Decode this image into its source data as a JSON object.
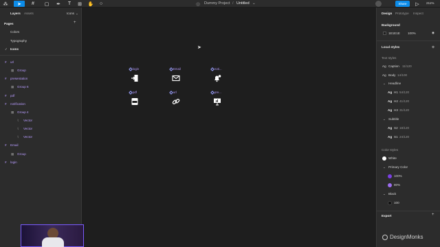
{
  "toolbar": {
    "project": "Dummy Project",
    "file": "Untitled",
    "share": "Share",
    "zoom": "211%",
    "design_tab": "Design",
    "prototype_tab": "Prototype",
    "inspect_tab": "Inspect"
  },
  "left": {
    "tab_layers": "Layers",
    "tab_assets": "Assets",
    "page_current": "Icons",
    "pages_label": "Pages",
    "pages": [
      "Colors",
      "Typography",
      "Icons"
    ],
    "layers": [
      {
        "label": "url",
        "level": 0,
        "type": "frame"
      },
      {
        "label": "Group",
        "level": 1,
        "type": "group"
      },
      {
        "label": "presentation",
        "level": 0,
        "type": "frame"
      },
      {
        "label": "Group 6",
        "level": 1,
        "type": "group"
      },
      {
        "label": "pdf",
        "level": 0,
        "type": "frame"
      },
      {
        "label": "notification",
        "level": 0,
        "type": "frame"
      },
      {
        "label": "Group 4",
        "level": 1,
        "type": "group"
      },
      {
        "label": "Vector",
        "level": 2,
        "type": "vector"
      },
      {
        "label": "Vector",
        "level": 2,
        "type": "vector"
      },
      {
        "label": "Vector",
        "level": 2,
        "type": "vector"
      },
      {
        "label": "Email",
        "level": 0,
        "type": "frame"
      },
      {
        "label": "Group",
        "level": 1,
        "type": "group"
      },
      {
        "label": "login",
        "level": 0,
        "type": "frame"
      }
    ]
  },
  "canvas": {
    "icons": [
      {
        "label": "login",
        "icon": "login-icon"
      },
      {
        "label": "Email",
        "icon": "email-icon"
      },
      {
        "label": "noti...",
        "icon": "bell-icon"
      },
      {
        "label": "pdf",
        "icon": "pdf-icon"
      },
      {
        "label": "url",
        "icon": "link-icon"
      },
      {
        "label": "pre...",
        "icon": "presentation-icon"
      }
    ]
  },
  "right": {
    "background_label": "Background",
    "bg_hex": "1E1E1E",
    "bg_opacity": "100%",
    "local_styles": "Local styles",
    "text_styles": "Text styles",
    "text_items": [
      {
        "ag": "Ag",
        "name": "Caption",
        "spec": "11/120"
      },
      {
        "ag": "Ag",
        "name": "Body",
        "spec": "14/100"
      }
    ],
    "headline_group": "Headline",
    "headline_items": [
      {
        "ag": "Ag",
        "name": "H1",
        "spec": "54/120"
      },
      {
        "ag": "Ag",
        "name": "H2",
        "spec": "41/120"
      },
      {
        "ag": "Ag",
        "name": "H3",
        "spec": "31/120"
      }
    ],
    "subtitle_group": "Subtitle",
    "subtitle_items": [
      {
        "ag": "Ag",
        "name": "S2",
        "spec": "18/120"
      },
      {
        "ag": "Ag",
        "name": "S1",
        "spec": "24/120"
      }
    ],
    "color_styles": "Color styles",
    "white": "White",
    "primary_group": "Primary Color",
    "primary_items": [
      "100%",
      "80%"
    ],
    "black_group": "Black",
    "black_item": "100",
    "export": "Export"
  },
  "brand": "DesignMonks",
  "colors": {
    "accent": "#0c8ce9",
    "panel": "#2c2c2c",
    "canvas": "#1e1e1e",
    "primary": "#7b3fe4"
  }
}
